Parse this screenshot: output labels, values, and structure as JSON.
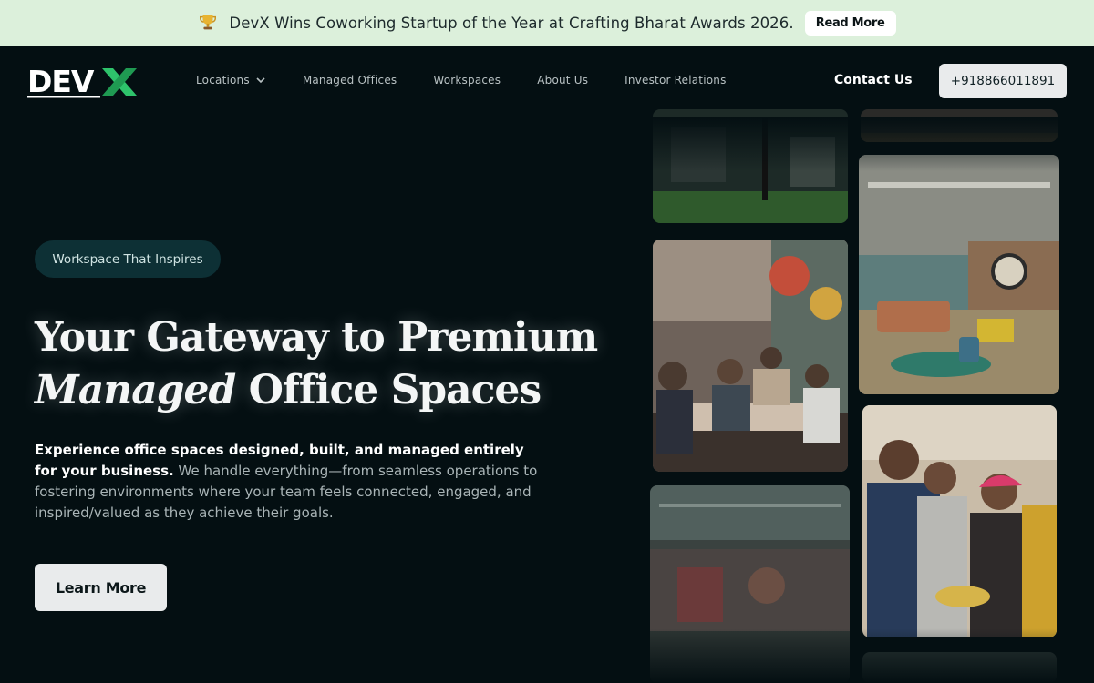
{
  "announcement": {
    "icon": "trophy-icon",
    "text": "DevX Wins Coworking Startup of the Year at Crafting Bharat Awards 2026.",
    "button_label": "Read More",
    "background": "#dcf0db"
  },
  "header": {
    "logo_text": "DEVX",
    "nav": [
      {
        "label": "Locations",
        "has_dropdown": true
      },
      {
        "label": "Managed Offices"
      },
      {
        "label": "Workspaces"
      },
      {
        "label": "About Us"
      },
      {
        "label": "Investor Relations"
      }
    ],
    "contact_label": "Contact Us",
    "phone_label": "+918866011891"
  },
  "hero": {
    "tag": "Workspace That Inspires",
    "headline_line1": "Your Gateway to Premium",
    "headline_emphasis": "Managed",
    "headline_line2_rest": " Office Spaces",
    "desc_bold": "Experience office spaces designed, built, and managed entirely for your business.",
    "desc_rest": " We handle everything—from seamless operations to fostering environments where your team feels connected, engaged, and inspired/valued as they achieve their goals.",
    "cta_label": "Learn More"
  },
  "gallery": {
    "images": [
      "office-interior-photo",
      "lounge-photo",
      "team-meeting-photo",
      "celebration-photo",
      "cafe-area-photo"
    ]
  },
  "colors": {
    "background": "#040f12",
    "brand_green": "#2ec36b",
    "pill_bg": "#0d3035"
  }
}
